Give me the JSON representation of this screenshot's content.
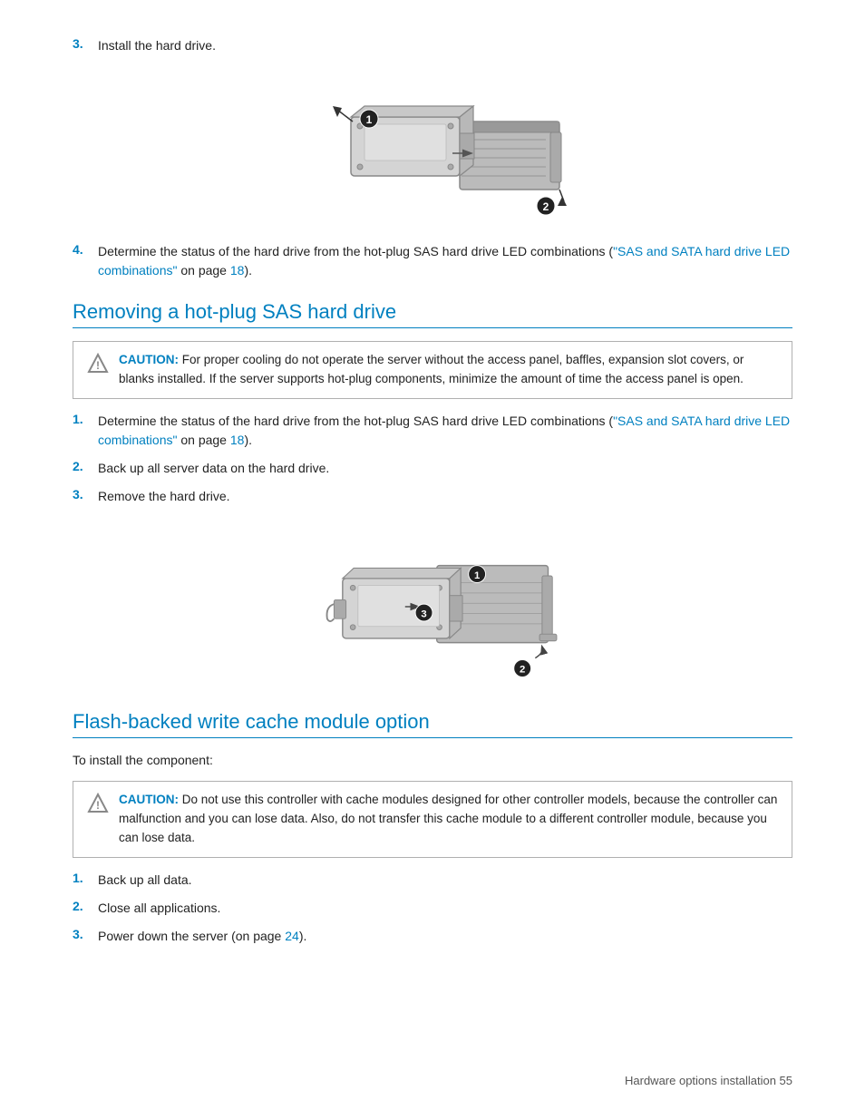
{
  "steps_install": {
    "step3": {
      "num": "3.",
      "text": "Install the hard drive."
    },
    "step4": {
      "num": "4.",
      "text": "Determine the status of the hard drive from the hot-plug SAS hard drive LED combinations (",
      "link_text": "\"SAS and SATA hard drive LED combinations\"",
      "text2": " on page ",
      "page_num": "18",
      "text3": ")."
    }
  },
  "section_removing": {
    "title": "Removing a hot-plug SAS hard drive"
  },
  "caution_removing": {
    "label": "CAUTION:",
    "text": " For proper cooling do not operate the server without the access panel, baffles, expansion slot covers, or blanks installed. If the server supports hot-plug components, minimize the amount of time the access panel is open."
  },
  "steps_removing": {
    "step1": {
      "num": "1.",
      "text": "Determine the status of the hard drive from the hot-plug SAS hard drive LED combinations (",
      "link_text": "\"SAS and SATA hard drive LED combinations\"",
      "text2": " on page ",
      "page_num": "18",
      "text3": ")."
    },
    "step2": {
      "num": "2.",
      "text": "Back up all server data on the hard drive."
    },
    "step3": {
      "num": "3.",
      "text": "Remove the hard drive."
    }
  },
  "section_flash": {
    "title": "Flash-backed write cache module option"
  },
  "intro_flash": {
    "text": "To install the component:"
  },
  "caution_flash": {
    "label": "CAUTION:",
    "text": " Do not use this controller with cache modules designed for other controller models, because the controller can malfunction and you can lose data. Also, do not transfer this cache module to a different controller module, because you can lose data."
  },
  "steps_flash": {
    "step1": {
      "num": "1.",
      "text": "Back up all data."
    },
    "step2": {
      "num": "2.",
      "text": "Close all applications."
    },
    "step3": {
      "num": "3.",
      "text": "Power down the server (on page ",
      "page_num": "24",
      "text2": ")."
    }
  },
  "footer": {
    "text": "Hardware options installation    55"
  }
}
